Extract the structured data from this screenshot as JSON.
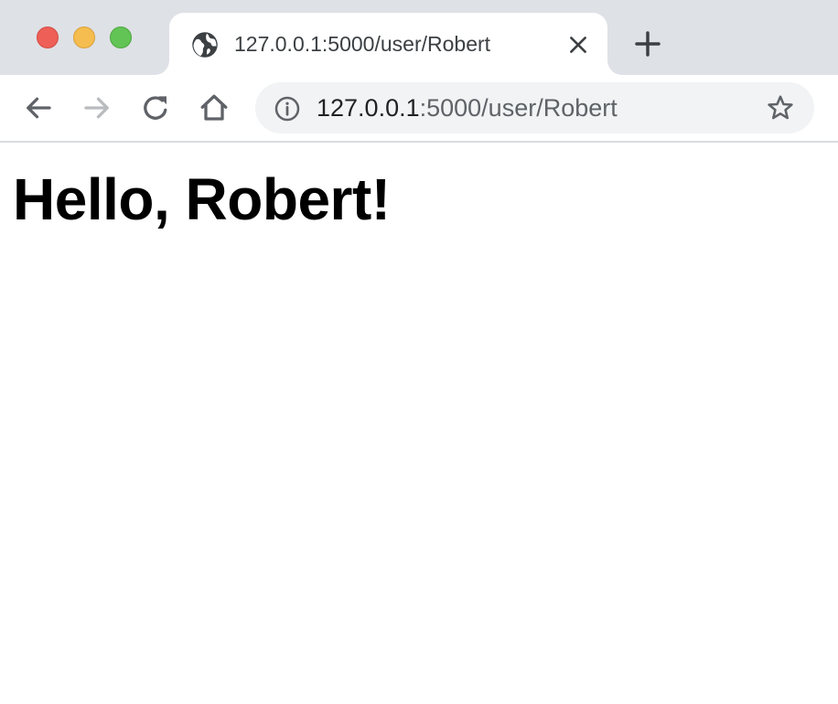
{
  "window": {
    "controls": [
      "close",
      "minimize",
      "zoom"
    ]
  },
  "tab": {
    "title": "127.0.0.1:5000/user/Robert",
    "favicon": "globe-icon",
    "close_icon": "close-icon"
  },
  "newtab": {
    "icon": "plus-icon"
  },
  "toolbar": {
    "back_icon": "arrow-left-icon",
    "forward_icon": "arrow-right-icon",
    "forward_enabled": false,
    "reload_icon": "reload-icon",
    "home_icon": "home-icon"
  },
  "address_bar": {
    "info_icon": "info-icon",
    "host": "127.0.0.1",
    "path": ":5000/user/Robert",
    "bookmark_icon": "star-icon"
  },
  "page": {
    "heading": "Hello, Robert!"
  },
  "colors": {
    "tabstrip": "#dee1e6",
    "omnibox": "#f1f3f4",
    "icon": "#5f6368",
    "icon_disabled": "#b9bbbe",
    "traffic_red": "#ee5f57",
    "traffic_yellow": "#f5bd4f",
    "traffic_green": "#61c454"
  }
}
